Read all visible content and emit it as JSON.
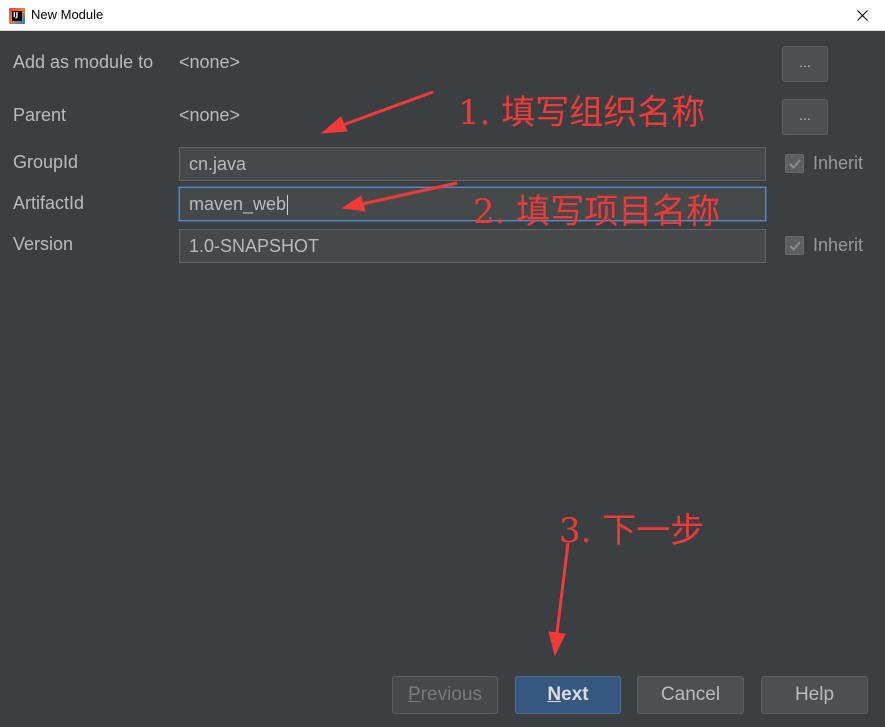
{
  "window": {
    "title": "New Module",
    "close_icon": "close-icon"
  },
  "form": {
    "add_as_module": {
      "label": "Add as module to",
      "value": "<none>",
      "button": "..."
    },
    "parent": {
      "label": "Parent",
      "value": "<none>",
      "button": "..."
    },
    "group_id": {
      "label": "GroupId",
      "value": "cn.java",
      "inherit_label": "Inherit",
      "inherit_checked": true
    },
    "artifact_id": {
      "label": "ArtifactId",
      "value": "maven_web"
    },
    "version": {
      "label": "Version",
      "value": "1.0-SNAPSHOT",
      "inherit_label": "Inherit",
      "inherit_checked": true
    }
  },
  "buttons": {
    "previous_mnemonic": "P",
    "previous_rest": "revious",
    "next_mnemonic": "N",
    "next_rest": "ext",
    "cancel": "Cancel",
    "help": "Help"
  },
  "annotations": {
    "step1": "1. 填写组织名称",
    "step2": "2. 填写项目名称",
    "step3": "3. 下一步",
    "color": "#f03a3a"
  },
  "colors": {
    "background": "#3c3f41",
    "primary_button": "#365880",
    "focus_border": "#5a86c2"
  }
}
